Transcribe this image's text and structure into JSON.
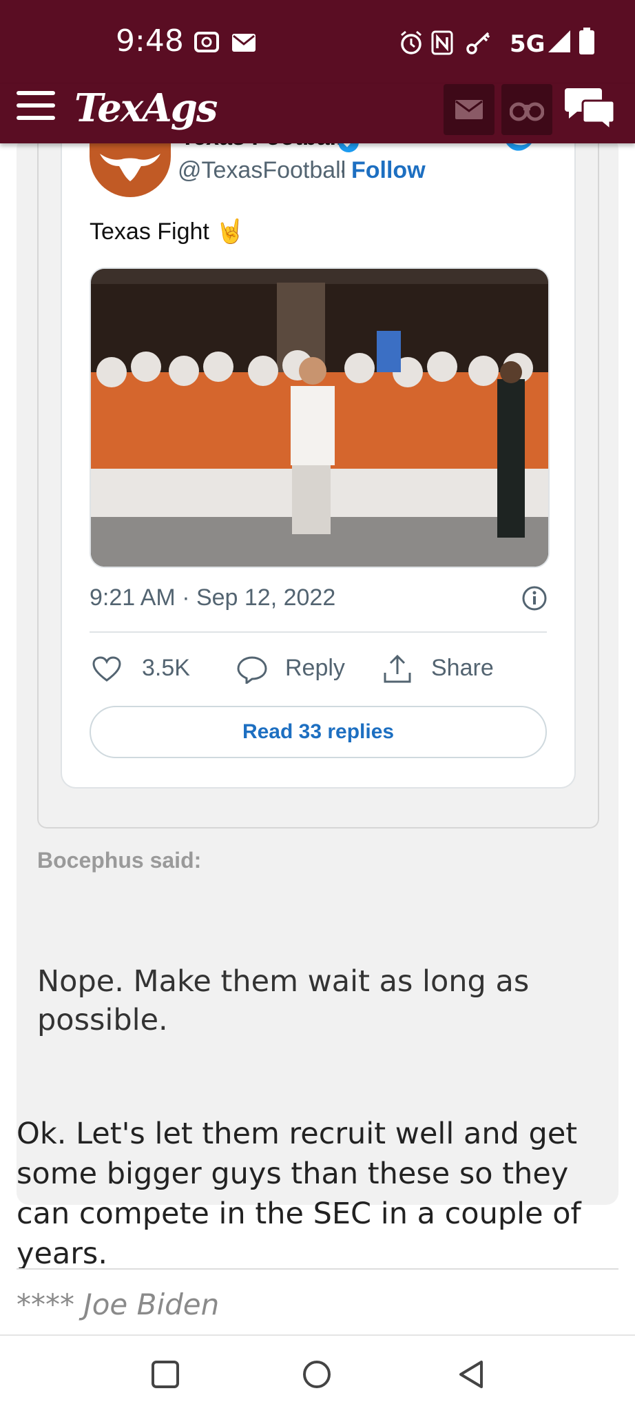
{
  "status_bar": {
    "time": "9:48",
    "network": "5G",
    "icons": [
      "screen-record-icon",
      "gmail-icon",
      "alarm-icon",
      "nfc-icon",
      "key-icon",
      "signal-icon",
      "battery-icon"
    ]
  },
  "app_bar": {
    "logo": "TexAgs",
    "icons": [
      "menu-icon",
      "mail-icon",
      "binoculars-icon",
      "chat-icon"
    ]
  },
  "tweet": {
    "name": "Texas Football",
    "handle": "@TexasFootball",
    "separator": "·",
    "follow": "Follow",
    "text": "Texas Fight",
    "emoji": "🤘",
    "date": "9:21 AM · Sep 12, 2022",
    "likes": "3.5K",
    "reply": "Reply",
    "share": "Share",
    "read_replies": "Read 33 replies"
  },
  "quote": {
    "author": "Bocephus said:",
    "text": "Nope. Make them wait as long as possible."
  },
  "post": {
    "text": "Ok. Let's let them recruit well and get some bigger guys than these so they can compete in the SEC in a couple of years.",
    "signature": "**** Joe Biden"
  },
  "colors": {
    "brand": "#5a0d23",
    "link": "#1d6fc1",
    "quote_bg": "#f1f1f1",
    "texas_orange": "#c15a25"
  }
}
